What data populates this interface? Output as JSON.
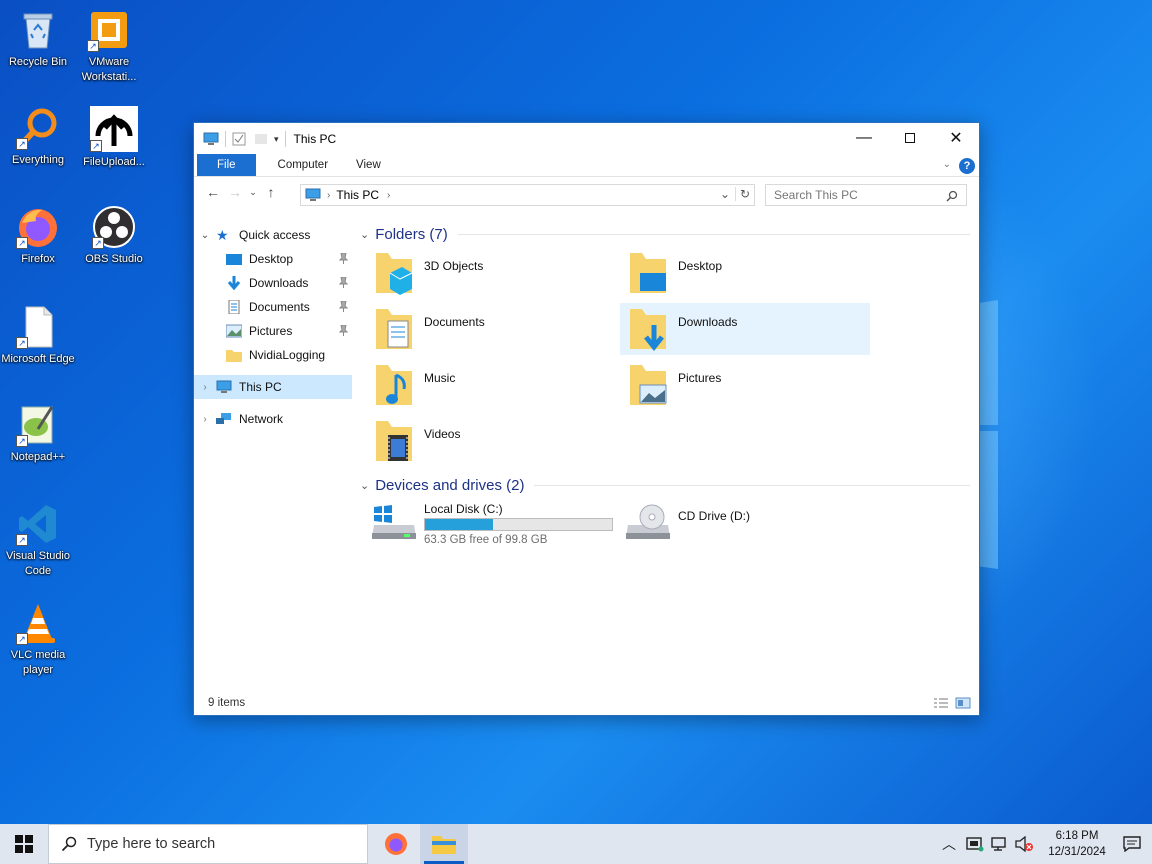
{
  "desktop": {
    "icons": [
      {
        "label": "Recycle Bin",
        "icon": "recycle-bin-icon"
      },
      {
        "label": "VMware Workstati...",
        "icon": "vmware-icon"
      },
      {
        "label": "Everything",
        "icon": "everything-search-icon"
      },
      {
        "label": "FileUpload...",
        "icon": "file-upload-icon"
      },
      {
        "label": "Firefox",
        "icon": "firefox-icon"
      },
      {
        "label": "OBS Studio",
        "icon": "obs-studio-icon"
      },
      {
        "label": "Microsoft Edge",
        "icon": "edge-file-icon"
      },
      {
        "label": "Notepad++",
        "icon": "notepad-plus-plus-icon"
      },
      {
        "label": "Visual Studio Code",
        "icon": "vscode-icon"
      },
      {
        "label": "VLC media player",
        "icon": "vlc-icon"
      }
    ]
  },
  "window": {
    "title": "This PC",
    "ribbon_tabs": [
      "File",
      "Computer",
      "View"
    ],
    "help_label": "?",
    "address": {
      "location": "This PC"
    },
    "search_placeholder": "Search This PC",
    "nav": {
      "quick_access": "Quick access",
      "quick_items": [
        "Desktop",
        "Downloads",
        "Documents",
        "Pictures",
        "NvidiaLogging"
      ],
      "this_pc": "This PC",
      "network": "Network"
    },
    "folders_header": "Folders (7)",
    "folders": [
      "3D Objects",
      "Desktop",
      "Documents",
      "Downloads",
      "Music",
      "Pictures",
      "Videos"
    ],
    "drives_header": "Devices and drives (2)",
    "drives": [
      {
        "name": "Local Disk (C:)",
        "free": "63.3 GB free of 99.8 GB",
        "used_fraction": 0.366
      },
      {
        "name": "CD Drive (D:)"
      }
    ],
    "status": "9 items"
  },
  "taskbar": {
    "search_placeholder": "Type here to search",
    "time": "6:18 PM",
    "date": "12/31/2024"
  },
  "colors": {
    "accent": "#1a6fd1",
    "desktop_bg": "#0b6fe0",
    "selection": "#cce8ff",
    "header_text": "#1e3287"
  }
}
